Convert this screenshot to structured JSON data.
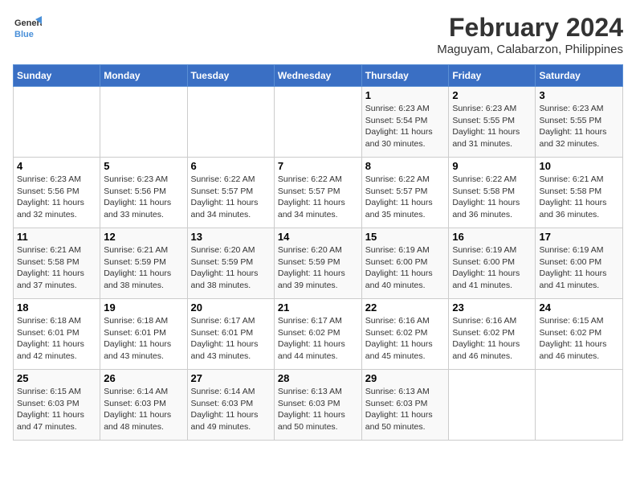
{
  "header": {
    "logo_line1": "General",
    "logo_line2": "Blue",
    "title": "February 2024",
    "subtitle": "Maguyam, Calabarzon, Philippines"
  },
  "days_of_week": [
    "Sunday",
    "Monday",
    "Tuesday",
    "Wednesday",
    "Thursday",
    "Friday",
    "Saturday"
  ],
  "weeks": [
    [
      {
        "day": "",
        "sunrise": "",
        "sunset": "",
        "daylight": ""
      },
      {
        "day": "",
        "sunrise": "",
        "sunset": "",
        "daylight": ""
      },
      {
        "day": "",
        "sunrise": "",
        "sunset": "",
        "daylight": ""
      },
      {
        "day": "",
        "sunrise": "",
        "sunset": "",
        "daylight": ""
      },
      {
        "day": "1",
        "sunrise": "6:23 AM",
        "sunset": "5:54 PM",
        "daylight": "11 hours and 30 minutes."
      },
      {
        "day": "2",
        "sunrise": "6:23 AM",
        "sunset": "5:55 PM",
        "daylight": "11 hours and 31 minutes."
      },
      {
        "day": "3",
        "sunrise": "6:23 AM",
        "sunset": "5:55 PM",
        "daylight": "11 hours and 32 minutes."
      }
    ],
    [
      {
        "day": "4",
        "sunrise": "6:23 AM",
        "sunset": "5:56 PM",
        "daylight": "11 hours and 32 minutes."
      },
      {
        "day": "5",
        "sunrise": "6:23 AM",
        "sunset": "5:56 PM",
        "daylight": "11 hours and 33 minutes."
      },
      {
        "day": "6",
        "sunrise": "6:22 AM",
        "sunset": "5:57 PM",
        "daylight": "11 hours and 34 minutes."
      },
      {
        "day": "7",
        "sunrise": "6:22 AM",
        "sunset": "5:57 PM",
        "daylight": "11 hours and 34 minutes."
      },
      {
        "day": "8",
        "sunrise": "6:22 AM",
        "sunset": "5:57 PM",
        "daylight": "11 hours and 35 minutes."
      },
      {
        "day": "9",
        "sunrise": "6:22 AM",
        "sunset": "5:58 PM",
        "daylight": "11 hours and 36 minutes."
      },
      {
        "day": "10",
        "sunrise": "6:21 AM",
        "sunset": "5:58 PM",
        "daylight": "11 hours and 36 minutes."
      }
    ],
    [
      {
        "day": "11",
        "sunrise": "6:21 AM",
        "sunset": "5:58 PM",
        "daylight": "11 hours and 37 minutes."
      },
      {
        "day": "12",
        "sunrise": "6:21 AM",
        "sunset": "5:59 PM",
        "daylight": "11 hours and 38 minutes."
      },
      {
        "day": "13",
        "sunrise": "6:20 AM",
        "sunset": "5:59 PM",
        "daylight": "11 hours and 38 minutes."
      },
      {
        "day": "14",
        "sunrise": "6:20 AM",
        "sunset": "5:59 PM",
        "daylight": "11 hours and 39 minutes."
      },
      {
        "day": "15",
        "sunrise": "6:19 AM",
        "sunset": "6:00 PM",
        "daylight": "11 hours and 40 minutes."
      },
      {
        "day": "16",
        "sunrise": "6:19 AM",
        "sunset": "6:00 PM",
        "daylight": "11 hours and 41 minutes."
      },
      {
        "day": "17",
        "sunrise": "6:19 AM",
        "sunset": "6:00 PM",
        "daylight": "11 hours and 41 minutes."
      }
    ],
    [
      {
        "day": "18",
        "sunrise": "6:18 AM",
        "sunset": "6:01 PM",
        "daylight": "11 hours and 42 minutes."
      },
      {
        "day": "19",
        "sunrise": "6:18 AM",
        "sunset": "6:01 PM",
        "daylight": "11 hours and 43 minutes."
      },
      {
        "day": "20",
        "sunrise": "6:17 AM",
        "sunset": "6:01 PM",
        "daylight": "11 hours and 43 minutes."
      },
      {
        "day": "21",
        "sunrise": "6:17 AM",
        "sunset": "6:02 PM",
        "daylight": "11 hours and 44 minutes."
      },
      {
        "day": "22",
        "sunrise": "6:16 AM",
        "sunset": "6:02 PM",
        "daylight": "11 hours and 45 minutes."
      },
      {
        "day": "23",
        "sunrise": "6:16 AM",
        "sunset": "6:02 PM",
        "daylight": "11 hours and 46 minutes."
      },
      {
        "day": "24",
        "sunrise": "6:15 AM",
        "sunset": "6:02 PM",
        "daylight": "11 hours and 46 minutes."
      }
    ],
    [
      {
        "day": "25",
        "sunrise": "6:15 AM",
        "sunset": "6:03 PM",
        "daylight": "11 hours and 47 minutes."
      },
      {
        "day": "26",
        "sunrise": "6:14 AM",
        "sunset": "6:03 PM",
        "daylight": "11 hours and 48 minutes."
      },
      {
        "day": "27",
        "sunrise": "6:14 AM",
        "sunset": "6:03 PM",
        "daylight": "11 hours and 49 minutes."
      },
      {
        "day": "28",
        "sunrise": "6:13 AM",
        "sunset": "6:03 PM",
        "daylight": "11 hours and 50 minutes."
      },
      {
        "day": "29",
        "sunrise": "6:13 AM",
        "sunset": "6:03 PM",
        "daylight": "11 hours and 50 minutes."
      },
      {
        "day": "",
        "sunrise": "",
        "sunset": "",
        "daylight": ""
      },
      {
        "day": "",
        "sunrise": "",
        "sunset": "",
        "daylight": ""
      }
    ]
  ]
}
